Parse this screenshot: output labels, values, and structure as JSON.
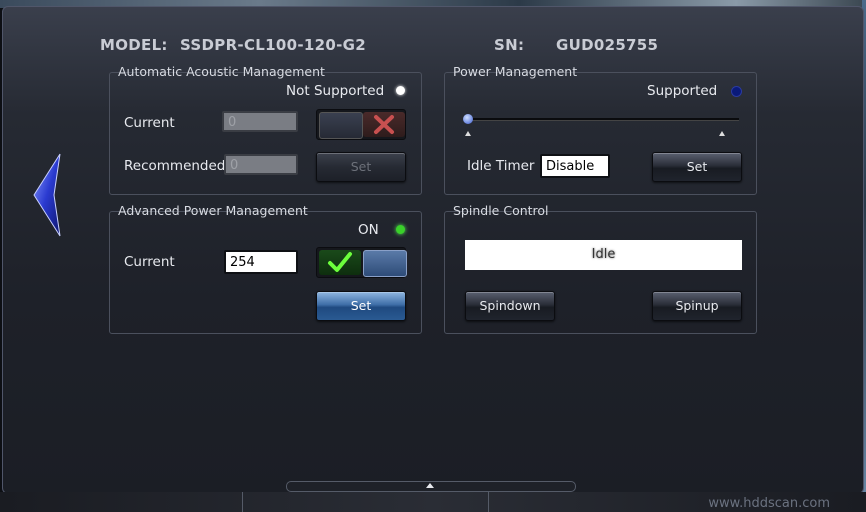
{
  "header": {
    "model_label": "MODEL:",
    "model_value": "SSDPR-CL100-120-G2",
    "sn_label": "SN:",
    "sn_value": "GUD025755"
  },
  "aam": {
    "title": "Automatic Acoustic Management",
    "status": "Not Supported",
    "status_color": "#ffffff",
    "current_label": "Current",
    "current_value": "0",
    "recommended_label": "Recommended",
    "recommended_value": "0",
    "set_label": "Set",
    "toggle_icon": "x-icon"
  },
  "power": {
    "title": "Power Management",
    "status": "Supported",
    "status_color": "#0a1a7a",
    "slider_level": 0,
    "idle_timer_label": "Idle Timer",
    "idle_timer_value": "Disable",
    "set_label": "Set"
  },
  "apm": {
    "title": "Advanced Power Management",
    "status": "ON",
    "status_color": "#3ad12a",
    "current_label": "Current",
    "current_value": "254",
    "set_label": "Set",
    "toggle_icon": "check-icon"
  },
  "spindle": {
    "title": "Spindle Control",
    "state": "Idle",
    "spindown_label": "Spindown",
    "spinup_label": "Spinup"
  },
  "watermark": "www.hddscan.com"
}
